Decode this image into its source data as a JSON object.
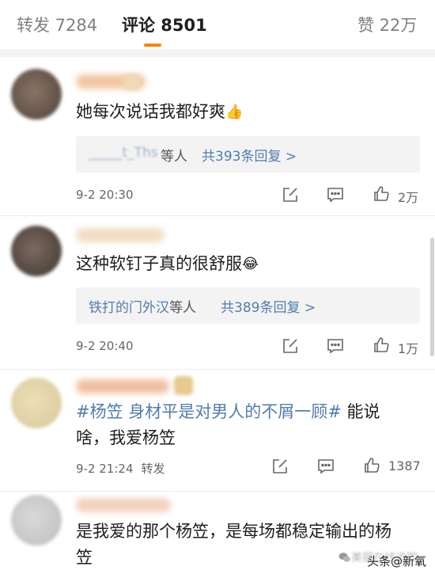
{
  "tabs": {
    "repost": "转发 7284",
    "comment": "评论 8501",
    "like": "赞 22万"
  },
  "colors": {
    "accent": "#ff8200",
    "link": "#507daf"
  },
  "comments": [
    {
      "text": "她每次说话我都好爽",
      "emoji": "👍",
      "reply_user": "_____t_Ths",
      "reply_suffix": "等人",
      "reply_count": "共393条回复 >",
      "time": "9-2 20:30",
      "likes": "2万"
    },
    {
      "text": "这种软钉子真的很舒服",
      "emoji": "😂",
      "reply_user": "铁打的门外汉",
      "reply_suffix": "等人",
      "reply_count": "共389条回复 >",
      "time": "9-2 20:40",
      "likes": "1万"
    },
    {
      "hashtag": "#杨笠 身材平是对男人的不屑一顾#",
      "text_tail": " 能说",
      "text_line2": "啥，我爱杨笠",
      "time": "9-2 21:24",
      "repost_tag": "转发",
      "likes": "1387"
    },
    {
      "text_line1": "是我爱的那个杨笠，是每场都稳定输出的杨",
      "text_line2": "笠"
    }
  ],
  "icons": [
    "share-icon",
    "comment-icon",
    "like-icon"
  ],
  "watermark": {
    "text": "头条@新氧",
    "background_text": "美丽在线追踪"
  }
}
